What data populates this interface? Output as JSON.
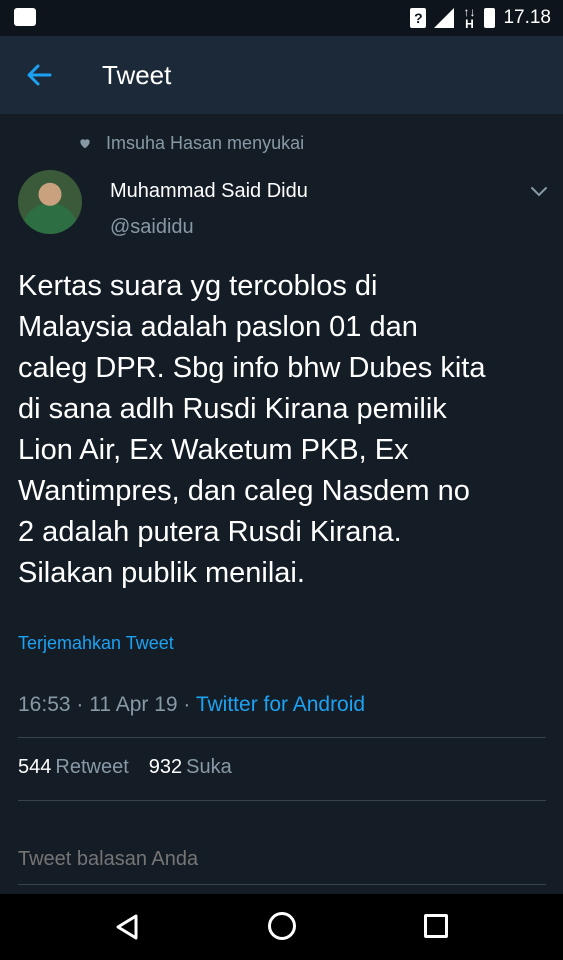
{
  "status_bar": {
    "time": "17.18",
    "network_label": "H",
    "icons": [
      "notification-icon",
      "sim-icon",
      "signal-icon",
      "network-icon",
      "battery-icon"
    ]
  },
  "app_bar": {
    "title": "Tweet"
  },
  "tweet": {
    "liked_by": "Imsuha Hasan menyukai",
    "author_name": "Muhammad Said Didu",
    "author_handle": "@saididu",
    "text": "Kertas suara yg tercoblos di\nMalaysia adalah paslon 01 dan\ncaleg DPR. Sbg info bhw Dubes kita\ndi sana adlh Rusdi Kirana pemilik\nLion Air, Ex Waketum PKB, Ex\nWantimpres, dan caleg Nasdem no\n2 adalah putera Rusdi Kirana.\nSilakan publik menilai.",
    "translate_label": "Terjemahkan Tweet",
    "timestamp": "16:53 · 11 Apr 19 · ",
    "source": "Twitter for Android",
    "retweet_count": "544",
    "retweet_label": "Retweet",
    "like_count": "932",
    "like_label": "Suka"
  },
  "reply": {
    "placeholder": "Tweet balasan Anda"
  },
  "colors": {
    "background": "#141d26",
    "app_bar": "#1c2938",
    "accent": "#1da1f2",
    "secondary_text": "#8899a6"
  }
}
